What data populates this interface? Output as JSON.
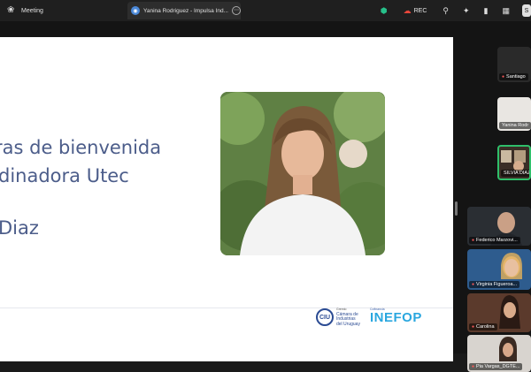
{
  "window": {
    "meeting_label": "Meeting",
    "tab_title": "Yanina Rodriguez - Impulsa Ind...",
    "rec_label": "REC",
    "corner_label": "S"
  },
  "slide": {
    "lines": [
      "ras de bienvenida",
      "dinadora Utec",
      "Diaz"
    ],
    "logos": {
      "camara_small": "Gremio",
      "camara_lines": [
        "Cámara de",
        "Industrias",
        "del Uruguay"
      ],
      "inefop_small": "Cofinancia",
      "inefop": "INEFOP"
    }
  },
  "participants": [
    {
      "name": "Santiago"
    },
    {
      "name": "Yanina Rodr"
    },
    {
      "name": "SILVIA DIAZ"
    },
    {
      "name": "Federico Marzovi..."
    },
    {
      "name": "Virginia Figueroa..."
    },
    {
      "name": "Carolina"
    },
    {
      "name": "Pia Vargas_DGTE..."
    }
  ],
  "colors": {
    "slide_text": "#4c5d8a",
    "active_speaker": "#2fbf6a",
    "mic_muted": "#ff5a5a",
    "shield": "#27c08a"
  },
  "icons": [
    "paw-icon",
    "tab-avatar-icon",
    "more-icon",
    "shield-icon",
    "cloud-record-icon",
    "link-icon",
    "sparkle-icon",
    "sidebar-icon",
    "grid-icon",
    "mic-off-icon"
  ]
}
